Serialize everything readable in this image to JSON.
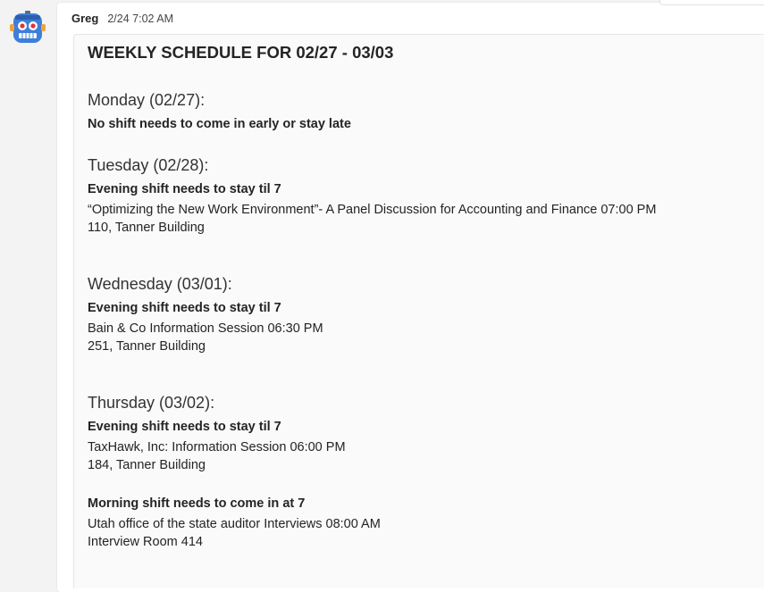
{
  "message": {
    "sender": "Greg",
    "timestamp": "2/24 7:02 AM",
    "avatar_icon": "robot-icon"
  },
  "schedule": {
    "title": "WEEKLY SCHEDULE FOR 02/27 - 03/03",
    "days": [
      {
        "heading": "Monday (02/27):",
        "blocks": [
          {
            "shift": "No shift needs to come in early or stay late",
            "event": "",
            "location": ""
          }
        ]
      },
      {
        "heading": "Tuesday (02/28):",
        "blocks": [
          {
            "shift": "Evening shift needs to stay til 7",
            "event": "“Optimizing the New Work Environment”- A Panel Discussion for Accounting and Finance 07:00 PM",
            "location": "110, Tanner Building"
          }
        ]
      },
      {
        "heading": "Wednesday (03/01):",
        "blocks": [
          {
            "shift": "Evening shift needs to stay til 7",
            "event": "Bain & Co Information Session 06:30 PM",
            "location": "251, Tanner Building"
          }
        ]
      },
      {
        "heading": "Thursday (03/02):",
        "blocks": [
          {
            "shift": "Evening shift needs to stay til 7",
            "event": "TaxHawk, Inc: Information Session 06:00 PM",
            "location": "184, Tanner Building"
          },
          {
            "shift": "Morning shift needs to come in at 7",
            "event": "Utah office of the state auditor Interviews 08:00 AM",
            "location": "Interview Room 414"
          }
        ]
      }
    ]
  }
}
